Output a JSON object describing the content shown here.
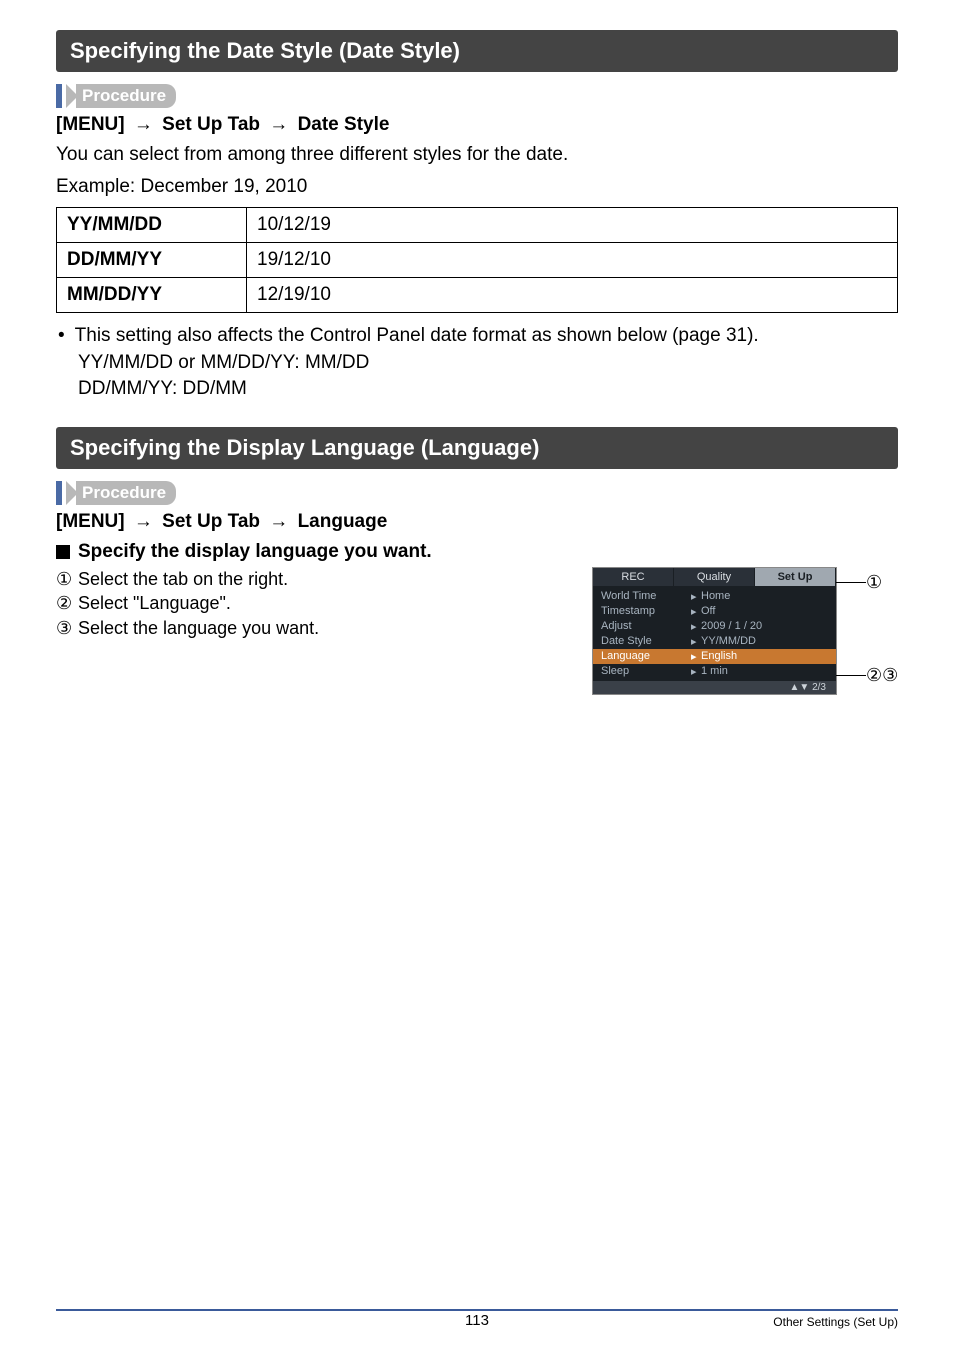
{
  "section1": {
    "title": "Specifying the Date Style (Date Style)",
    "procedure_label": "Procedure",
    "breadcrumb": {
      "part1": "[MENU]",
      "part2": "Set Up Tab",
      "part3": "Date Style"
    },
    "intro1": "You can select from among three different styles for the date.",
    "intro2": "Example: December 19, 2010",
    "table": [
      {
        "k": "YY/MM/DD",
        "v": "10/12/19"
      },
      {
        "k": "DD/MM/YY",
        "v": "19/12/10"
      },
      {
        "k": "MM/DD/YY",
        "v": "12/19/10"
      }
    ],
    "note_line1": "This setting also affects the Control Panel date format as shown below (page 31).",
    "note_line2": "YY/MM/DD or MM/DD/YY: MM/DD",
    "note_line3": "DD/MM/YY: DD/MM"
  },
  "section2": {
    "title": "Specifying the Display Language (Language)",
    "procedure_label": "Procedure",
    "breadcrumb": {
      "part1": "[MENU]",
      "part2": "Set Up Tab",
      "part3": "Language"
    },
    "subheading": "Specify the display language you want.",
    "steps": [
      "Select the tab on the right.",
      "Select \"Language\".",
      "Select the language you want."
    ],
    "annotations": {
      "a1": "①",
      "a2": "②",
      "a3": "③"
    },
    "camera": {
      "tabs": [
        "REC",
        "Quality",
        "Set Up"
      ],
      "rows": [
        {
          "k": "World Time",
          "v": "Home"
        },
        {
          "k": "Timestamp",
          "v": "Off"
        },
        {
          "k": "Adjust",
          "v": "2009 /   1 / 20"
        },
        {
          "k": "Date Style",
          "v": "YY/MM/DD"
        },
        {
          "k": "Language",
          "v": "English",
          "hl": true
        },
        {
          "k": "Sleep",
          "v": "1 min"
        }
      ],
      "footer": "▲▼ 2/3"
    }
  },
  "footer": {
    "page": "113",
    "section": "Other Settings (Set Up)"
  },
  "step_markers": [
    "①",
    "②",
    "③"
  ]
}
